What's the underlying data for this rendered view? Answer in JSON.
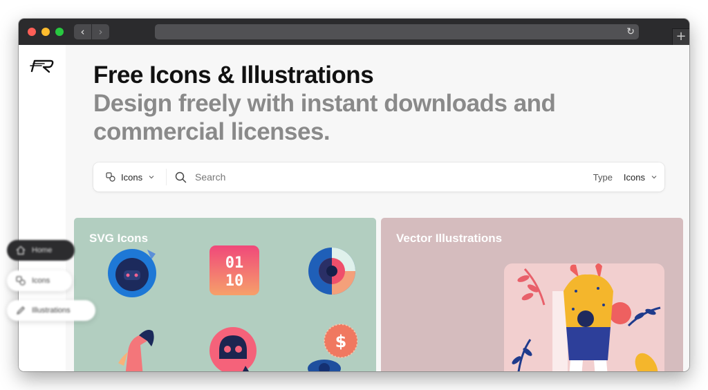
{
  "browser": {
    "back_symbol": "‹",
    "forward_symbol": "›",
    "reload_symbol": "↻",
    "new_tab_symbol": "+",
    "traffic_light_colors": [
      "#fe5f57",
      "#febc2e",
      "#28c840"
    ]
  },
  "sidebar": {
    "logo_icon": "brand-logo-icon"
  },
  "hero": {
    "title": "Free Icons & Illustrations",
    "subtitle": "Design freely with instant downloads and commercial licenses."
  },
  "search": {
    "category": "Icons",
    "placeholder": "Search",
    "type_label": "Type",
    "type_value": "Icons"
  },
  "cards": [
    {
      "title": "SVG Icons",
      "background": "#b2cec0"
    },
    {
      "title": "Vector Illustrations",
      "background": "#d5bcbe"
    }
  ],
  "float_nav": {
    "items": [
      {
        "label": "Home",
        "icon": "home-icon",
        "active": true
      },
      {
        "label": "Icons",
        "icon": "icons-icon",
        "active": false
      },
      {
        "label": "Illustrations",
        "icon": "pencil-icon",
        "active": false
      }
    ]
  }
}
